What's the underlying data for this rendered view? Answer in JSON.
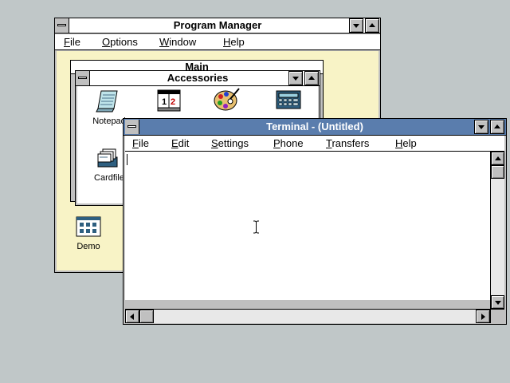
{
  "program_manager": {
    "title": "Program Manager",
    "menu": [
      "File",
      "Options",
      "Window",
      "Help"
    ],
    "main_group_title": "Main",
    "accessories": {
      "title": "Accessories",
      "icons": [
        "Notepad",
        "Calendar",
        "Paintbrush",
        "Calculator",
        "Cardfile"
      ]
    },
    "demo_label": "Demo"
  },
  "terminal": {
    "title": "Terminal - (Untitled)",
    "menu": [
      "File",
      "Edit",
      "Settings",
      "Phone",
      "Transfers",
      "Help"
    ]
  },
  "colors": {
    "desktop": "#c0c7c8",
    "active_title": "#5a7dad",
    "workspace": "#f8f3c6"
  }
}
